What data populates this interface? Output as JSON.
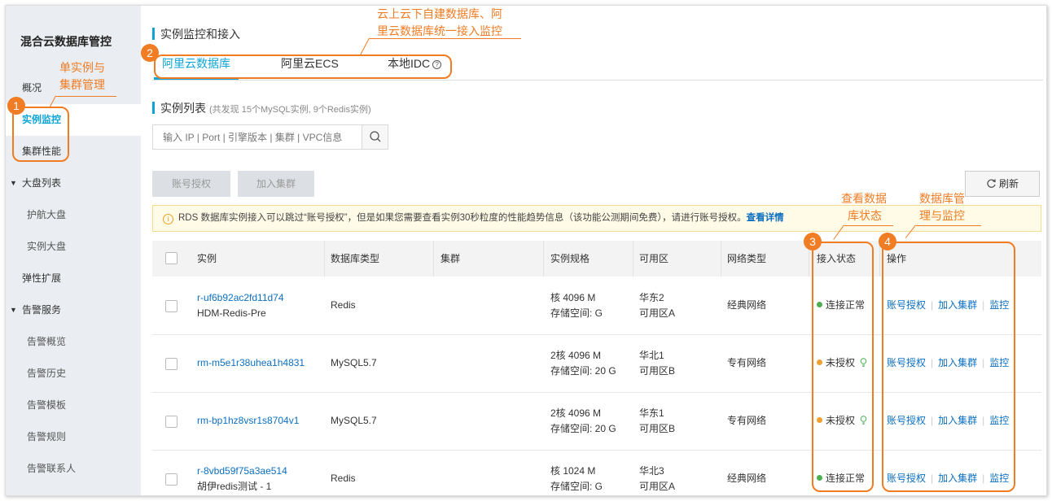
{
  "sidebar": {
    "title": "混合云数据库管控",
    "items": [
      {
        "label": "概况"
      },
      {
        "label": "实例监控"
      },
      {
        "label": "集群性能"
      },
      {
        "label": "大盘列表"
      },
      {
        "label": "护航大盘"
      },
      {
        "label": "实例大盘"
      },
      {
        "label": "弹性扩展"
      },
      {
        "label": "告警服务"
      },
      {
        "label": "告警概览"
      },
      {
        "label": "告警历史"
      },
      {
        "label": "告警模板"
      },
      {
        "label": "告警规则"
      },
      {
        "label": "告警联系人"
      }
    ]
  },
  "header": {
    "title": "实例监控和接入",
    "tabs": [
      {
        "label": "阿里云数据库"
      },
      {
        "label": "阿里云ECS"
      },
      {
        "label": "本地IDC"
      }
    ],
    "help_icon": "?"
  },
  "instances": {
    "section_title": "实例列表",
    "section_subtitle": "(共发现 15个MySQL实例, 9个Redis实例)",
    "search_placeholder": "输入 IP | Port | 引擎版本 | 集群 | VPC信息",
    "buttons": {
      "authorize": "账号授权",
      "add_cluster": "加入集群",
      "refresh": "刷新"
    },
    "notice": {
      "icon": "i",
      "text": "RDS 数据库实例接入可以跳过“账号授权”，但是如果您需要查看实例30秒粒度的性能趋势信息（该功能公测期间免费），请进行账号授权。",
      "link": "查看详情"
    },
    "columns": [
      "实例",
      "数据库类型",
      "集群",
      "实例规格",
      "可用区",
      "网络类型",
      "接入状态",
      "操作"
    ],
    "rows": [
      {
        "id": "r-uf6b92ac2fd11d74",
        "name": "HDM-Redis-Pre",
        "db_type": "Redis",
        "cluster": "",
        "spec1": "核 4096 M",
        "spec2": "存储空间: G",
        "region": "华东2",
        "zone": "可用区A",
        "network": "经典网络",
        "status": "连接正常",
        "status_color": "#4caf50",
        "bulb": false
      },
      {
        "id": "rm-m5e1r38uhea1h4831",
        "name": "",
        "db_type": "MySQL5.7",
        "cluster": "",
        "spec1": "2核 4096 M",
        "spec2": "存储空间: 20 G",
        "region": "华北1",
        "zone": "可用区B",
        "network": "专有网络",
        "status": "未授权",
        "status_color": "#f0a030",
        "bulb": true
      },
      {
        "id": "rm-bp1hz8vsr1s8704v1",
        "name": "",
        "db_type": "MySQL5.7",
        "cluster": "",
        "spec1": "2核 4096 M",
        "spec2": "存储空间: 20 G",
        "region": "华东1",
        "zone": "可用区B",
        "network": "专有网络",
        "status": "未授权",
        "status_color": "#f0a030",
        "bulb": true
      },
      {
        "id": "r-8vbd59f75a3ae514",
        "name": "胡伊redis测试 - 1",
        "db_type": "Redis",
        "cluster": "",
        "spec1": "核 1024 M",
        "spec2": "存储空间: G",
        "region": "华北3",
        "zone": "可用区A",
        "network": "经典网络",
        "status": "连接正常",
        "status_color": "#4caf50",
        "bulb": false
      }
    ],
    "row_actions": [
      "账号授权",
      "加入集群",
      "监控"
    ]
  },
  "annotations": {
    "n1": "1",
    "n2": "2",
    "n3": "3",
    "n4": "4",
    "a1_line1": "单实例与",
    "a1_line2": "集群管理",
    "a2_line1": "云上云下自建数据库、阿",
    "a2_line2": "里云数据库统一接入监控",
    "a3_line1": "查看数据",
    "a3_line2": "库状态",
    "a4_line1": "数据库管",
    "a4_line2": "理与监控",
    "color": "#f07c24"
  },
  "colors": {
    "accent": "#0ea5d6",
    "link": "#0b6fc2",
    "annotation": "#f07c24"
  }
}
